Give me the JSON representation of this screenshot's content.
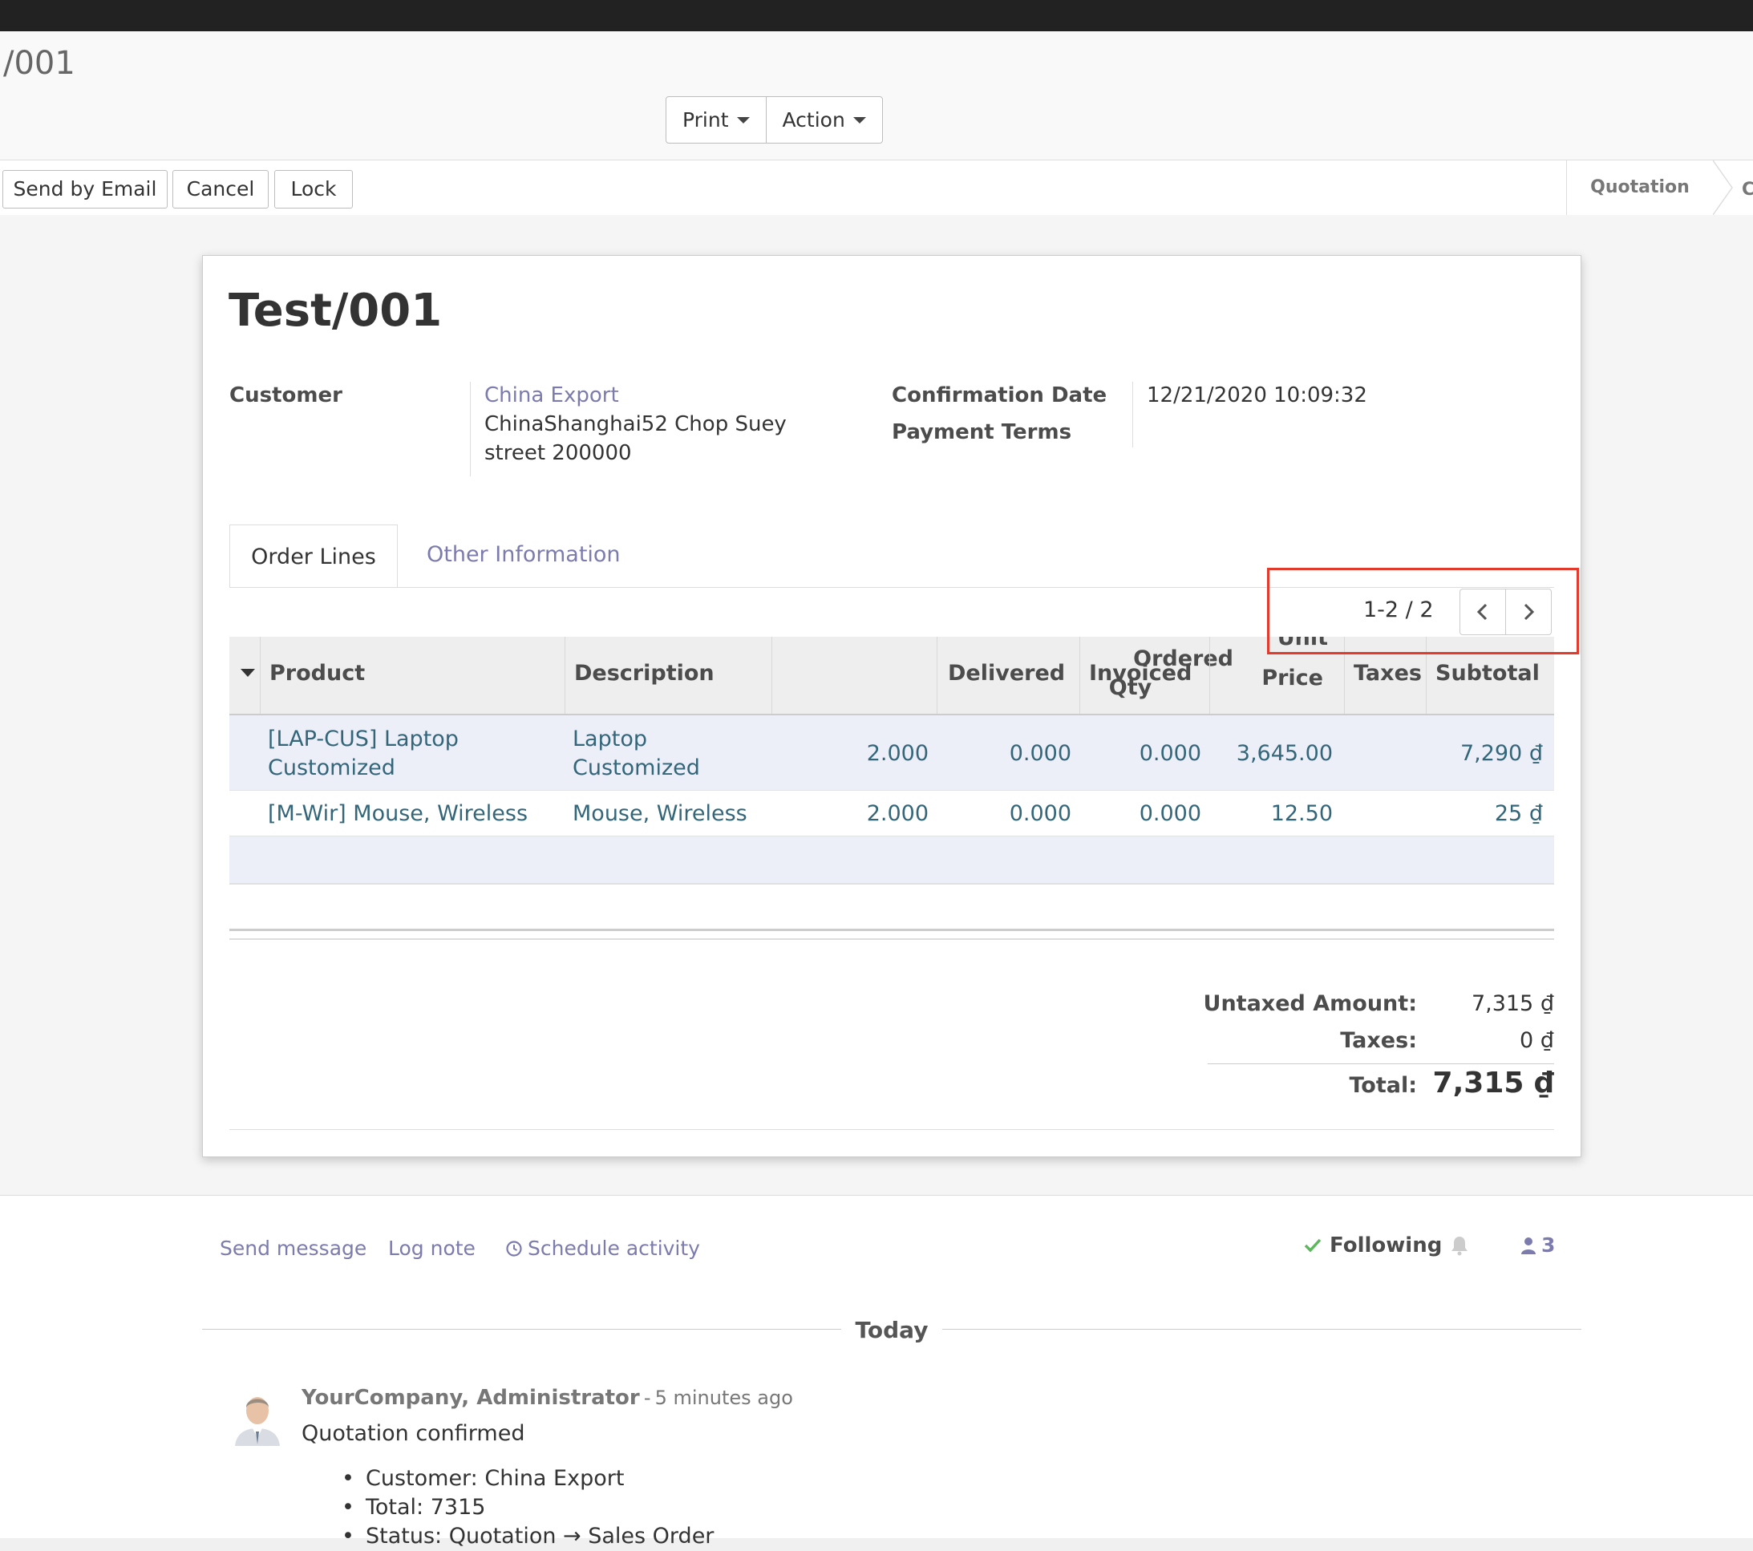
{
  "breadcrumb": {
    "current": "/001"
  },
  "toolbar": {
    "print_label": "Print",
    "action_label": "Action"
  },
  "statusbar": {
    "buttons": [
      "Send by Email",
      "Cancel",
      "Lock"
    ],
    "stage_current": "Quotation",
    "stage_next_partial": "C"
  },
  "order": {
    "title": "Test/001",
    "customer_label": "Customer",
    "customer_name": "China Export",
    "customer_address_line1": "ChinaShanghai52 Chop Suey",
    "customer_address_line2": "street 200000",
    "confirmation_date_label": "Confirmation Date",
    "confirmation_date": "12/21/2020 10:09:32",
    "payment_terms_label": "Payment Terms"
  },
  "tabs": {
    "order_lines": "Order Lines",
    "other_info": "Other Information"
  },
  "pager": {
    "value": "1-2 / 2"
  },
  "table": {
    "headers": {
      "product": "Product",
      "description": "Description",
      "ordered_qty_1": "Ordered",
      "ordered_qty_2": "Qty",
      "delivered": "Delivered",
      "invoiced": "Invoiced",
      "unit_price_1": "Unit",
      "unit_price_2": "Price",
      "taxes": "Taxes",
      "subtotal": "Subtotal"
    },
    "rows": [
      {
        "product_1": "[LAP-CUS] Laptop",
        "product_2": "Customized",
        "description_1": "Laptop",
        "description_2": "Customized",
        "ordered_qty": "2.000",
        "delivered": "0.000",
        "invoiced": "0.000",
        "unit_price": "3,645.00",
        "taxes": "",
        "subtotal": "7,290 ₫"
      },
      {
        "product_1": "[M-Wir] Mouse, Wireless",
        "description_1": "Mouse, Wireless",
        "ordered_qty": "2.000",
        "delivered": "0.000",
        "invoiced": "0.000",
        "unit_price": "12.50",
        "taxes": "",
        "subtotal": "25 ₫"
      }
    ]
  },
  "totals": {
    "untaxed_label": "Untaxed Amount:",
    "untaxed_value": "7,315 ₫",
    "taxes_label": "Taxes:",
    "taxes_value": "0 ₫",
    "total_label": "Total:",
    "total_value": "7,315 ₫"
  },
  "chatter": {
    "send_message": "Send message",
    "log_note": "Log note",
    "schedule_activity": "Schedule activity",
    "following": "Following",
    "followers_count": "3",
    "date_separator": "Today",
    "message": {
      "author": "YourCompany, Administrator",
      "dash": "-",
      "time": "5 minutes ago",
      "body": "Quotation confirmed",
      "changes": [
        "Customer: China Export",
        "Total: 7315",
        "Status: Quotation → Sales Order"
      ]
    }
  },
  "colors": {
    "link": "#7c7bad",
    "line_link": "#34667a",
    "highlight_box": "#e23b2e",
    "topbar": "#222222",
    "following_check": "#5cb85c"
  }
}
